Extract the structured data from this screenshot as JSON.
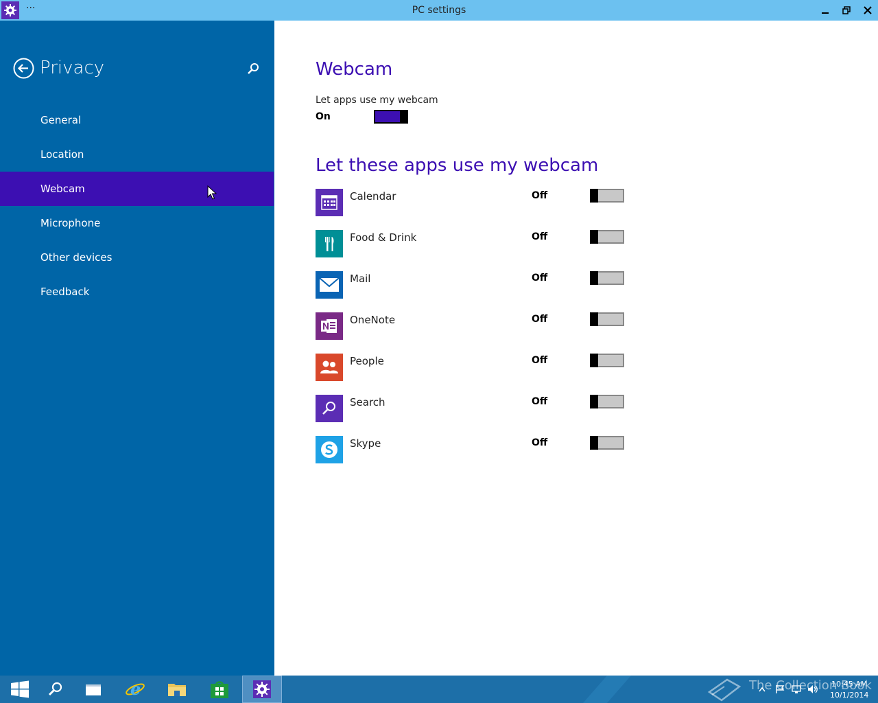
{
  "window": {
    "title": "PC settings",
    "menu_glyph": "···"
  },
  "sidebar": {
    "title": "Privacy",
    "items": [
      {
        "label": "General"
      },
      {
        "label": "Location"
      },
      {
        "label": "Webcam"
      },
      {
        "label": "Microphone"
      },
      {
        "label": "Other devices"
      },
      {
        "label": "Feedback"
      }
    ],
    "active_index": 2
  },
  "main": {
    "heading": "Webcam",
    "master_label": "Let apps use my webcam",
    "master_state": "On",
    "apps_heading": "Let these apps use my webcam",
    "apps": [
      {
        "name": "Calendar",
        "state": "Off",
        "color": "#5b2db4",
        "icon": "calendar-icon"
      },
      {
        "name": "Food & Drink",
        "state": "Off",
        "color": "#008f96",
        "icon": "fork-knife-icon"
      },
      {
        "name": "Mail",
        "state": "Off",
        "color": "#0a64b4",
        "icon": "envelope-icon"
      },
      {
        "name": "OneNote",
        "state": "Off",
        "color": "#7a2a86",
        "icon": "onenote-icon"
      },
      {
        "name": "People",
        "state": "Off",
        "color": "#d9482b",
        "icon": "people-icon"
      },
      {
        "name": "Search",
        "state": "Off",
        "color": "#5b2db4",
        "icon": "magnifier-icon"
      },
      {
        "name": "Skype",
        "state": "Off",
        "color": "#1fa2e6",
        "icon": "skype-icon"
      }
    ]
  },
  "taskbar": {
    "watermark": "The Collection Book",
    "time": "10:45 AM",
    "date": "10/1/2014"
  },
  "colors": {
    "accent": "#3c0fb2",
    "sidebar_bg": "#0065a7",
    "titlebar_bg": "#6cc1f0"
  }
}
